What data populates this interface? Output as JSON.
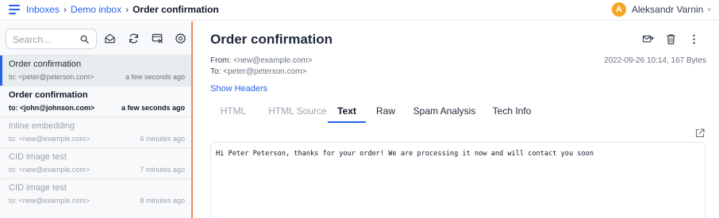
{
  "breadcrumb": {
    "items": [
      "Inboxes",
      "Demo inbox"
    ],
    "separator": "›",
    "current": "Order confirmation"
  },
  "user": {
    "initial": "A",
    "name": "Aleksandr Varnin",
    "chevron": "˅",
    "avatar_color": "#f5a623"
  },
  "search": {
    "placeholder": "Search..."
  },
  "toolbar_icons": [
    "search-icon",
    "mark-read-icon",
    "refresh-icon",
    "clear-inbox-icon",
    "settings-icon"
  ],
  "messages": [
    {
      "subject": "Order confirmation",
      "to": "to: <peter@peterson.com>",
      "time": "a few seconds ago",
      "state": "active"
    },
    {
      "subject": "Order confirmation",
      "to": "to: <john@johnson.com>",
      "time": "a few seconds ago",
      "state": "unread"
    },
    {
      "subject": "inline embedding",
      "to": "to: <new@example.com>",
      "time": "6 minutes ago",
      "state": "read"
    },
    {
      "subject": "CID image test",
      "to": "to: <new@example.com>",
      "time": "7 minutes ago",
      "state": "read"
    },
    {
      "subject": "CID image test",
      "to": "to: <new@example.com>",
      "time": "8 minutes ago",
      "state": "read"
    }
  ],
  "message": {
    "title": "Order confirmation",
    "from_label": "From:",
    "from": "<new@example.com>",
    "to_label": "To:",
    "to": "<peter@peterson.com>",
    "date_size": "2022-09-26 10:14, 167 Bytes",
    "show_headers": "Show Headers",
    "actions": [
      "forward-icon",
      "delete-icon",
      "more-icon"
    ],
    "tabs": [
      "HTML",
      "HTML Source",
      "Text",
      "Raw",
      "Spam Analysis",
      "Tech Info"
    ],
    "active_tab": "Text",
    "body": "Hi Peter Peterson, thanks for your order! We are processing it now and will contact you soon"
  },
  "colors": {
    "accent": "#2563eb",
    "sidebar_border": "#f08a5d",
    "sidebar_bg": "#f8f9fa",
    "active_item_bg": "#e9ecef"
  }
}
